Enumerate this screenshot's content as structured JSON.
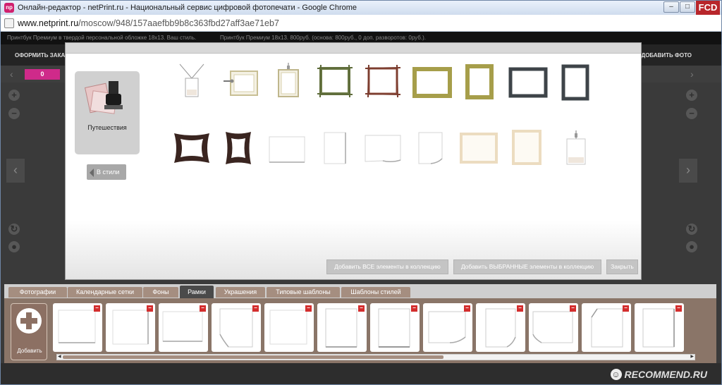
{
  "browser": {
    "title": "Онлайн-редактор - netPrint.ru - Национальный сервис цифровой фотопечати - Google Chrome",
    "url_host": "www.netprint.ru",
    "url_path": "/moscow/948/157aaefbb9b8c363fbd27aff3ae71eb7",
    "minimize_icon": "minimize-icon",
    "maximize_icon": "maximize-icon",
    "close_icon": "close-icon",
    "overlay_label": "FCD"
  },
  "app": {
    "info_left": "Принтбук Премиум в твердой персональной обложке 18х13. Ваш стиль.",
    "info_right": "Принтбук Премиум 18х13. 800руб. (основа: 800руб., 0 доп. разворотов: 0руб.).",
    "menu_left": "ОФОРМИТЬ  ЗАКА",
    "menu_right": "ДОБАВИТЬ ФОТО",
    "page_number": "0",
    "accent_color": "#cf2a8a"
  },
  "modal": {
    "style_name": "Путешествия",
    "back_label": "В стили",
    "buttons": [
      {
        "label": "Добавить ВСЕ элементы в коллекцию"
      },
      {
        "label": "Добавить ВЫБРАННЫЕ элементы в коллекцию"
      },
      {
        "label": "Закрыть"
      }
    ],
    "frames_row1": [
      "tag-frame",
      "pinned-frame",
      "hanging-frame",
      "twig-frame",
      "brown-twig-frame",
      "olive-frame",
      "olive-frame-tall",
      "dark-gray-frame",
      "dark-gray-frame-tall"
    ],
    "frames_row2": [
      "bent-dark-frame",
      "bent-dark-frame-tall",
      "white-frame",
      "white-frame-tall",
      "white-curl-frame",
      "white-curl-frame-tall",
      "cream-frame",
      "cream-frame-tall",
      "tag-frame-small"
    ]
  },
  "tabs": [
    {
      "label": "Фотографии"
    },
    {
      "label": "Календарные сетки"
    },
    {
      "label": "Фоны"
    },
    {
      "label": "Рамки"
    },
    {
      "label": "Украшения"
    },
    {
      "label": "Типовые шаблоны"
    },
    {
      "label": "Шаблоны стилей"
    }
  ],
  "active_tab": "Рамки",
  "collection": {
    "add_label": "Добавить",
    "remove_symbol": "−",
    "thumbnails": [
      "thumb-1",
      "thumb-2",
      "thumb-3",
      "thumb-4",
      "thumb-5",
      "thumb-6",
      "thumb-7",
      "thumb-8",
      "thumb-9",
      "thumb-10",
      "thumb-11",
      "thumb-12"
    ]
  },
  "watermark": {
    "text": "RECOMMEND.RU",
    "icon_char": "☺"
  }
}
